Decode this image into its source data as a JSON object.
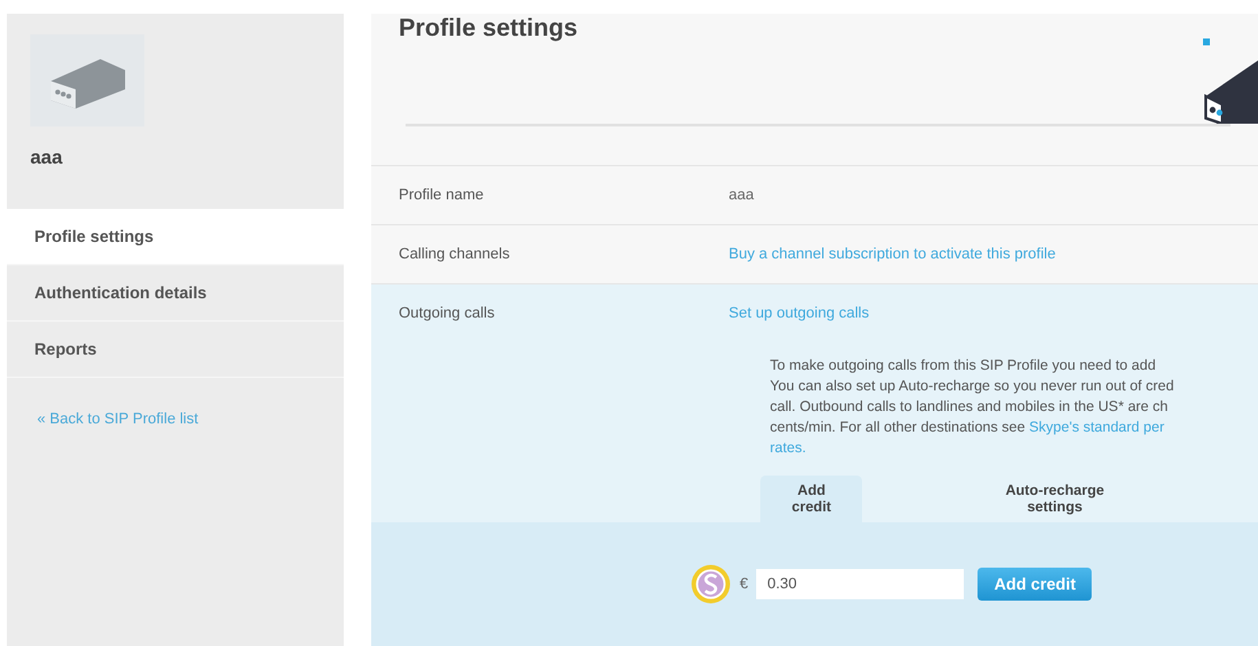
{
  "sidebar": {
    "profile_name": "aaa",
    "items": [
      {
        "label": "Profile settings",
        "selected": true
      },
      {
        "label": "Authentication details",
        "selected": false
      },
      {
        "label": "Reports",
        "selected": false
      }
    ],
    "back_link": "« Back to SIP Profile list"
  },
  "main": {
    "title": "Profile settings",
    "rows": [
      {
        "label": "Profile name",
        "value": "aaa",
        "kind": "text"
      },
      {
        "label": "Calling channels",
        "value": "Buy a channel subscription to activate this profile",
        "kind": "link"
      },
      {
        "label": "Outgoing calls",
        "value": "Set up outgoing calls",
        "kind": "link"
      }
    ],
    "info_lines": [
      {
        "text": "To make outgoing calls from this SIP Profile you need to add"
      },
      {
        "text": "You can also set up Auto-recharge so you never run out of cred"
      },
      {
        "text": "call. Outbound calls to landlines and mobiles in the US* are ch"
      },
      {
        "text": "cents/min. For all other destinations see ",
        "link": "Skype's standard per"
      },
      {
        "link": "rates."
      }
    ],
    "tabs": [
      {
        "label": "Add credit",
        "selected": true
      },
      {
        "label": "Auto-recharge settings",
        "selected": false
      }
    ],
    "currency": "€",
    "amount": "0.30",
    "button": "Add credit"
  }
}
